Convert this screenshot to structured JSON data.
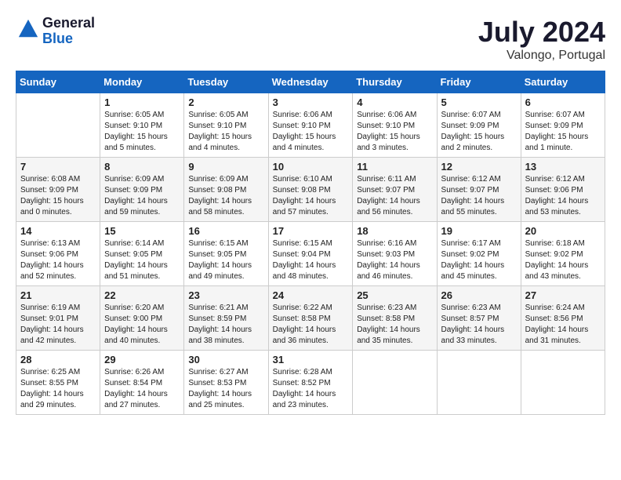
{
  "logo": {
    "line1": "General",
    "line2": "Blue"
  },
  "title": "July 2024",
  "subtitle": "Valongo, Portugal",
  "days_of_week": [
    "Sunday",
    "Monday",
    "Tuesday",
    "Wednesday",
    "Thursday",
    "Friday",
    "Saturday"
  ],
  "weeks": [
    [
      {
        "day": "",
        "info": ""
      },
      {
        "day": "1",
        "info": "Sunrise: 6:05 AM\nSunset: 9:10 PM\nDaylight: 15 hours\nand 5 minutes."
      },
      {
        "day": "2",
        "info": "Sunrise: 6:05 AM\nSunset: 9:10 PM\nDaylight: 15 hours\nand 4 minutes."
      },
      {
        "day": "3",
        "info": "Sunrise: 6:06 AM\nSunset: 9:10 PM\nDaylight: 15 hours\nand 4 minutes."
      },
      {
        "day": "4",
        "info": "Sunrise: 6:06 AM\nSunset: 9:10 PM\nDaylight: 15 hours\nand 3 minutes."
      },
      {
        "day": "5",
        "info": "Sunrise: 6:07 AM\nSunset: 9:09 PM\nDaylight: 15 hours\nand 2 minutes."
      },
      {
        "day": "6",
        "info": "Sunrise: 6:07 AM\nSunset: 9:09 PM\nDaylight: 15 hours\nand 1 minute."
      }
    ],
    [
      {
        "day": "7",
        "info": "Sunrise: 6:08 AM\nSunset: 9:09 PM\nDaylight: 15 hours\nand 0 minutes."
      },
      {
        "day": "8",
        "info": "Sunrise: 6:09 AM\nSunset: 9:09 PM\nDaylight: 14 hours\nand 59 minutes."
      },
      {
        "day": "9",
        "info": "Sunrise: 6:09 AM\nSunset: 9:08 PM\nDaylight: 14 hours\nand 58 minutes."
      },
      {
        "day": "10",
        "info": "Sunrise: 6:10 AM\nSunset: 9:08 PM\nDaylight: 14 hours\nand 57 minutes."
      },
      {
        "day": "11",
        "info": "Sunrise: 6:11 AM\nSunset: 9:07 PM\nDaylight: 14 hours\nand 56 minutes."
      },
      {
        "day": "12",
        "info": "Sunrise: 6:12 AM\nSunset: 9:07 PM\nDaylight: 14 hours\nand 55 minutes."
      },
      {
        "day": "13",
        "info": "Sunrise: 6:12 AM\nSunset: 9:06 PM\nDaylight: 14 hours\nand 53 minutes."
      }
    ],
    [
      {
        "day": "14",
        "info": "Sunrise: 6:13 AM\nSunset: 9:06 PM\nDaylight: 14 hours\nand 52 minutes."
      },
      {
        "day": "15",
        "info": "Sunrise: 6:14 AM\nSunset: 9:05 PM\nDaylight: 14 hours\nand 51 minutes."
      },
      {
        "day": "16",
        "info": "Sunrise: 6:15 AM\nSunset: 9:05 PM\nDaylight: 14 hours\nand 49 minutes."
      },
      {
        "day": "17",
        "info": "Sunrise: 6:15 AM\nSunset: 9:04 PM\nDaylight: 14 hours\nand 48 minutes."
      },
      {
        "day": "18",
        "info": "Sunrise: 6:16 AM\nSunset: 9:03 PM\nDaylight: 14 hours\nand 46 minutes."
      },
      {
        "day": "19",
        "info": "Sunrise: 6:17 AM\nSunset: 9:02 PM\nDaylight: 14 hours\nand 45 minutes."
      },
      {
        "day": "20",
        "info": "Sunrise: 6:18 AM\nSunset: 9:02 PM\nDaylight: 14 hours\nand 43 minutes."
      }
    ],
    [
      {
        "day": "21",
        "info": "Sunrise: 6:19 AM\nSunset: 9:01 PM\nDaylight: 14 hours\nand 42 minutes."
      },
      {
        "day": "22",
        "info": "Sunrise: 6:20 AM\nSunset: 9:00 PM\nDaylight: 14 hours\nand 40 minutes."
      },
      {
        "day": "23",
        "info": "Sunrise: 6:21 AM\nSunset: 8:59 PM\nDaylight: 14 hours\nand 38 minutes."
      },
      {
        "day": "24",
        "info": "Sunrise: 6:22 AM\nSunset: 8:58 PM\nDaylight: 14 hours\nand 36 minutes."
      },
      {
        "day": "25",
        "info": "Sunrise: 6:23 AM\nSunset: 8:58 PM\nDaylight: 14 hours\nand 35 minutes."
      },
      {
        "day": "26",
        "info": "Sunrise: 6:23 AM\nSunset: 8:57 PM\nDaylight: 14 hours\nand 33 minutes."
      },
      {
        "day": "27",
        "info": "Sunrise: 6:24 AM\nSunset: 8:56 PM\nDaylight: 14 hours\nand 31 minutes."
      }
    ],
    [
      {
        "day": "28",
        "info": "Sunrise: 6:25 AM\nSunset: 8:55 PM\nDaylight: 14 hours\nand 29 minutes."
      },
      {
        "day": "29",
        "info": "Sunrise: 6:26 AM\nSunset: 8:54 PM\nDaylight: 14 hours\nand 27 minutes."
      },
      {
        "day": "30",
        "info": "Sunrise: 6:27 AM\nSunset: 8:53 PM\nDaylight: 14 hours\nand 25 minutes."
      },
      {
        "day": "31",
        "info": "Sunrise: 6:28 AM\nSunset: 8:52 PM\nDaylight: 14 hours\nand 23 minutes."
      },
      {
        "day": "",
        "info": ""
      },
      {
        "day": "",
        "info": ""
      },
      {
        "day": "",
        "info": ""
      }
    ]
  ]
}
